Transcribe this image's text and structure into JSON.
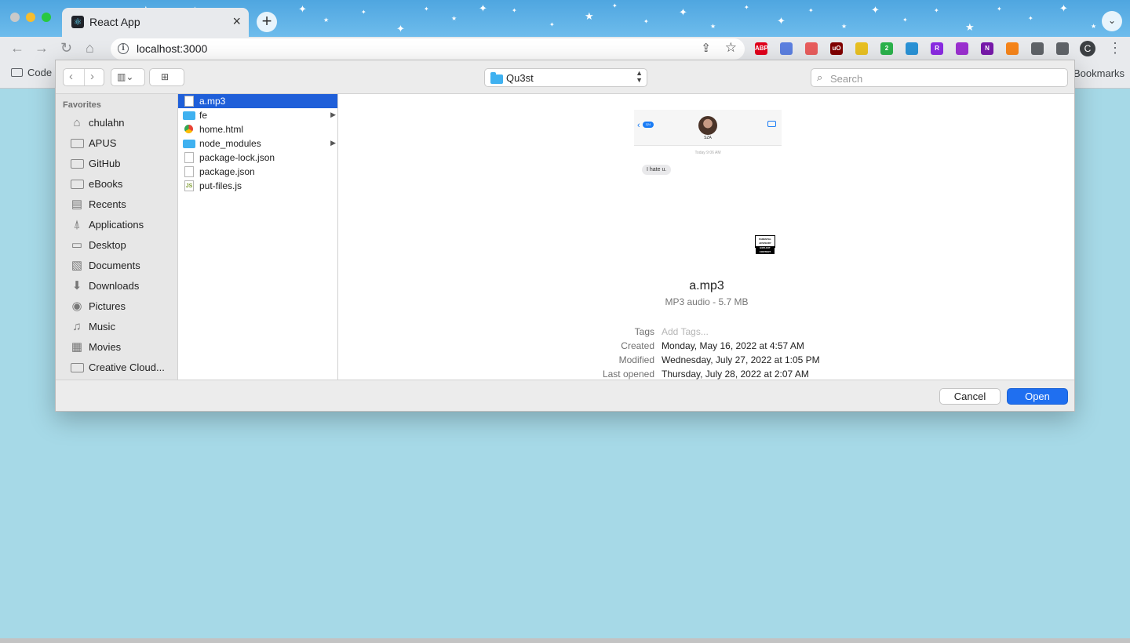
{
  "browser": {
    "tab": {
      "title": "React App",
      "close_icon": "close-icon",
      "favicon": "react-icon"
    },
    "new_tab_glyph": "+",
    "omnibox": {
      "url": "localhost:3000"
    },
    "profile_initial": "C",
    "bookmarks_left": "Code",
    "bookmarks_right": "Bookmarks",
    "extensions": [
      {
        "name": "adblock-plus-icon",
        "text": "ABP",
        "color": "#e0001b"
      },
      {
        "name": "camera-icon",
        "text": "",
        "color": "#5b7fe0"
      },
      {
        "name": "pdf-icon",
        "text": "",
        "color": "#e85d5d"
      },
      {
        "name": "ublock-icon",
        "text": "uO",
        "color": "#800000"
      },
      {
        "name": "lightning-icon",
        "text": "",
        "color": "#e8c022"
      },
      {
        "name": "pulse-icon",
        "text": "2",
        "color": "#2bb24c"
      },
      {
        "name": "window-icon",
        "text": "",
        "color": "#2a92d6"
      },
      {
        "name": "r-icon",
        "text": "R",
        "color": "#8a2be2"
      },
      {
        "name": "circle-icon",
        "text": "",
        "color": "#9b30d0"
      },
      {
        "name": "onenote-icon",
        "text": "N",
        "color": "#7719aa"
      },
      {
        "name": "metamask-icon",
        "text": "",
        "color": "#f6851b"
      },
      {
        "name": "puzzle-icon",
        "text": "",
        "color": "#5f6368"
      },
      {
        "name": "sidepanel-icon",
        "text": "",
        "color": "#5f6368"
      }
    ]
  },
  "dialog": {
    "location": "Qu3st",
    "search_placeholder": "Search",
    "sidebar": {
      "heading": "Favorites",
      "items": [
        {
          "label": "chulahn",
          "icon": "home-icon"
        },
        {
          "label": "APUS",
          "icon": "folder-icon"
        },
        {
          "label": "GitHub",
          "icon": "folder-icon"
        },
        {
          "label": "eBooks",
          "icon": "folder-icon"
        },
        {
          "label": "Recents",
          "icon": "clock-icon"
        },
        {
          "label": "Applications",
          "icon": "applications-icon"
        },
        {
          "label": "Desktop",
          "icon": "desktop-icon"
        },
        {
          "label": "Documents",
          "icon": "document-icon"
        },
        {
          "label": "Downloads",
          "icon": "download-icon"
        },
        {
          "label": "Pictures",
          "icon": "camera-icon"
        },
        {
          "label": "Music",
          "icon": "music-icon"
        },
        {
          "label": "Movies",
          "icon": "film-icon"
        },
        {
          "label": "Creative Cloud...",
          "icon": "folder-icon"
        }
      ]
    },
    "files": [
      {
        "name": "a.mp3",
        "kind": "file",
        "selected": true
      },
      {
        "name": "fe",
        "kind": "folder",
        "selected": false
      },
      {
        "name": "home.html",
        "kind": "chrome",
        "selected": false
      },
      {
        "name": "node_modules",
        "kind": "folder",
        "selected": false
      },
      {
        "name": "package-lock.json",
        "kind": "file",
        "selected": false
      },
      {
        "name": "package.json",
        "kind": "file",
        "selected": false
      },
      {
        "name": "put-files.js",
        "kind": "js",
        "selected": false
      }
    ],
    "preview": {
      "thumbnail": {
        "badge": "324",
        "contact": "SZA",
        "time": "Today 9:06 AM",
        "message": "I hate u.",
        "advisory_top": "PARENTAL ADVISORY",
        "advisory_bottom": "EXPLICIT CONTENT"
      },
      "title": "a.mp3",
      "subtitle": "MP3 audio - 5.7 MB",
      "meta": [
        {
          "label": "Tags",
          "value": "Add Tags...",
          "placeholder": true
        },
        {
          "label": "Created",
          "value": "Monday, May 16, 2022 at 4:57 AM",
          "placeholder": false
        },
        {
          "label": "Modified",
          "value": "Wednesday, July 27, 2022 at 1:05 PM",
          "placeholder": false
        },
        {
          "label": "Last opened",
          "value": "Thursday, July 28, 2022 at 2:07 AM",
          "placeholder": false
        }
      ]
    },
    "buttons": {
      "cancel": "Cancel",
      "open": "Open"
    }
  }
}
